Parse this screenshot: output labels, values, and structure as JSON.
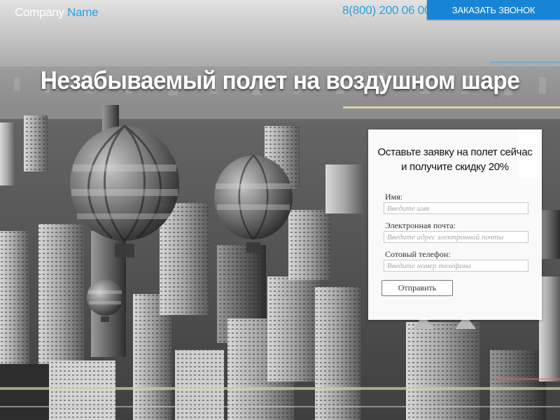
{
  "header": {
    "logo_main": "Company",
    "logo_accent": "Name",
    "phone": "8(800) 200 06 00",
    "callback_label": "Заказать звонок"
  },
  "hero": {
    "title": "Незабываемый полет на воздушном шаре"
  },
  "form": {
    "heading_line1": "Оставьте заявку на полет сейчас",
    "heading_line2": "и получите скидку 20%",
    "fields": [
      {
        "label": "Имя:",
        "placeholder": "Введите имя"
      },
      {
        "label": "Электронная почта:",
        "placeholder": "Введите адрес электронной почты"
      },
      {
        "label": "Сотовый телефон:",
        "placeholder": "Введите номер телефона"
      }
    ],
    "submit_label": "Отправить"
  },
  "colors": {
    "accent": "#2aa0e0",
    "button": "#1784d4"
  }
}
